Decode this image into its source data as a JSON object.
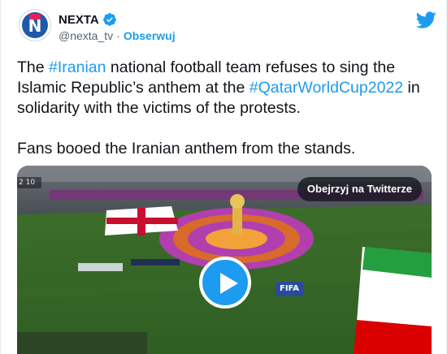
{
  "account": {
    "display_name": "NEXTA",
    "handle": "@nexta_tv",
    "separator": "·",
    "follow_label": "Obserwuj",
    "avatar_letter": "N"
  },
  "tweet": {
    "line1_part1": "The ",
    "hashtag1": "#Iranian",
    "line1_part2": " national football team refuses to sing the Islamic Republic’s anthem at the ",
    "hashtag2": "#QatarWorldCup2022",
    "line1_part3": "  in solidarity with the victims of the protests.",
    "paragraph2": "Fans booed the Iranian anthem from the stands."
  },
  "media": {
    "watch_label": "Obejrzyj na Twitterze",
    "fifa_text": "FIFA",
    "score_text": "2 10"
  },
  "colors": {
    "link": "#1d9bf0",
    "text": "#0f1419",
    "muted": "#536471",
    "play": "#1d9bf0"
  },
  "icons": [
    "verified-icon",
    "twitter-bird-icon",
    "play-icon"
  ]
}
